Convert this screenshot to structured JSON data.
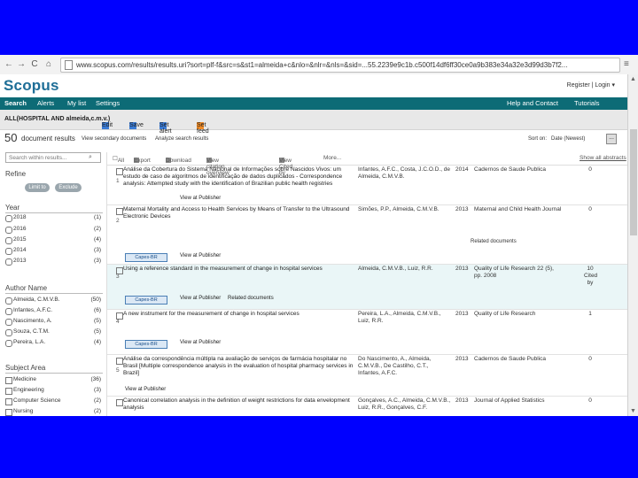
{
  "browser": {
    "url": "www.scopus.com/results/results.uri?sort=plf-f&src=s&st1=almeida+c&nlo=&nlr=&nls=&sid=...55.2239e9c1b.c500f14df6ff30ce0a9b383e34a32e3d99d3b7f2...",
    "back": "←",
    "forward": "→",
    "reload": "C",
    "home": "⌂",
    "menu": "≡"
  },
  "header": {
    "logo": "Scopus",
    "links": "Register  |  Login ▾"
  },
  "nav": {
    "search": "Search",
    "alerts": "Alerts",
    "my_list": "My list",
    "settings": "Settings",
    "help": "Help and Contact",
    "tutorials": "Tutorials"
  },
  "query_bar": {
    "query": "ALL(HOSPITAL AND almeida,c.m.v.)",
    "edit": "Edit",
    "save": "Save",
    "set_alert": "Set alert",
    "set_feed": "Set feed"
  },
  "results_count": {
    "number": "50",
    "label": "document results",
    "view_secondary": "View secondary documents",
    "analyze": "Analyze search results",
    "sort_on": "Sort on:",
    "sort_value": "Date (Newest)",
    "more": "..."
  },
  "sidebar": {
    "search_placeholder": "Search within results...",
    "search_icon": "search-icon",
    "refine": "Refine",
    "limit_to": "Limit to",
    "exclude": "Exclude",
    "year_h": "Year",
    "years": [
      {
        "label": "2018",
        "count": "(1)"
      },
      {
        "label": "2016",
        "count": "(2)"
      },
      {
        "label": "2015",
        "count": "(4)"
      },
      {
        "label": "2014",
        "count": "(3)"
      },
      {
        "label": "2013",
        "count": "(3)"
      }
    ],
    "author_h": "Author Name",
    "authors": [
      {
        "label": "Almeida, C.M.V.B.",
        "count": "(50)"
      },
      {
        "label": "Infantes, A.F.C.",
        "count": "(6)"
      },
      {
        "label": "Nascimento, A.",
        "count": "(5)"
      },
      {
        "label": "Souza, C.T.M.",
        "count": "(5)"
      },
      {
        "label": "Pereira, L.A.",
        "count": "(4)"
      }
    ],
    "subject_h": "Subject Area",
    "subjects": [
      {
        "label": "Medicine",
        "count": "(36)"
      },
      {
        "label": "Engineering",
        "count": "(3)"
      },
      {
        "label": "Computer Science",
        "count": "(2)"
      },
      {
        "label": "Nursing",
        "count": "(2)"
      }
    ]
  },
  "toolbar": {
    "all": "All",
    "export": "Export",
    "download": "Download",
    "view_citation": "View citation overview",
    "view_cited_by": "View Cited by",
    "more": "More...",
    "show_abstracts": "Show all abstracts"
  },
  "results": [
    {
      "num": "1",
      "title": "Análise da Cobertura do Sistema Nacional de Informações sobre Nascidos Vivos: um estudo de caso de algoritmos de identificação de dados duplicados - Correspondence analysis: Attempted study with the identification of Brazilian public health registries",
      "authors": "Infantes, A.F.C., Costa, J.C.O.D., de Almeida, C.M.V.B.",
      "year": "2014",
      "source": "Cadernos de Saude Publica",
      "cited": "0",
      "view_abstract": "View at Publisher"
    },
    {
      "num": "2",
      "title": "Maternal Mortality and Access to Health Services by Means of Transfer to the Ultrasound Electronic Devices",
      "authors": "Simões, P.P., Almeida, C.M.V.B.",
      "year": "2013",
      "source": "Maternal and Child Health Journal",
      "cited": "0",
      "capes": "Capes-BR",
      "view_abstract": "View at Publisher",
      "related": "Related documents"
    },
    {
      "num": "3",
      "title": "Using a reference standard in the measurement of change in hospital services",
      "authors": "Almeida, C.M.V.B., Luiz, R.R.",
      "year": "2013",
      "source": "Quality of Life Research 22 (5), pp. 2008",
      "cited": "10 Cited by",
      "capes": "Capes-BR",
      "view_abstract": "View at Publisher",
      "related": "Related documents"
    },
    {
      "num": "4",
      "title": "A new instrument for the measurement of change in hospital services",
      "authors": "Pereira, L.A., Almeida, C.M.V.B., Luiz, R.R.",
      "year": "2013",
      "source": "Quality of Life Research",
      "cited": "1",
      "capes": "Capes-BR",
      "view_abstract": "View at Publisher"
    },
    {
      "num": "5",
      "title": "Análise da correspondência múltipla na avaliação de serviços de farmácia hospitalar no Brasil [Multiple correspondence analysis in the evaluation of hospital pharmacy services in Brazil]",
      "authors": "Do Nascimento, A., Almeida, C.M.V.B., De Castilho, C.T., Infantes, A.F.C.",
      "year": "2013",
      "source": "Cadernos de Saude Publica",
      "cited": "0",
      "view_abstract": "View at Publisher"
    },
    {
      "num": "6",
      "title": "Canonical correlation analysis in the definition of weight restrictions for data envelopment analysis",
      "authors": "Gonçalves, A.C., Almeida, C.M.V.B., Luiz, R.R., Gonçalves, C.F.",
      "year": "2013",
      "source": "Journal of Applied Statistics",
      "cited": "0"
    }
  ]
}
